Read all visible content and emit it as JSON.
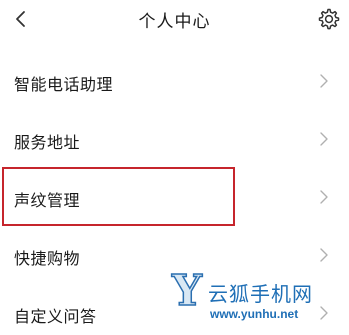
{
  "header": {
    "title": "个人中心",
    "back_icon": "chevron-left-icon",
    "settings_icon": "gear-icon"
  },
  "menu": {
    "items": [
      {
        "label": "智能电话助理"
      },
      {
        "label": "服务地址"
      },
      {
        "label": "声纹管理",
        "highlighted": true
      },
      {
        "label": "快捷购物"
      },
      {
        "label": "自定义问答"
      }
    ]
  },
  "watermark": {
    "letter": "Y",
    "name": "云狐手机网",
    "url": "www.yunhu.net"
  },
  "colors": {
    "highlight_border": "#c6252c",
    "watermark_blue": "#1f6fb6",
    "chevron": "#b0b0b0"
  }
}
